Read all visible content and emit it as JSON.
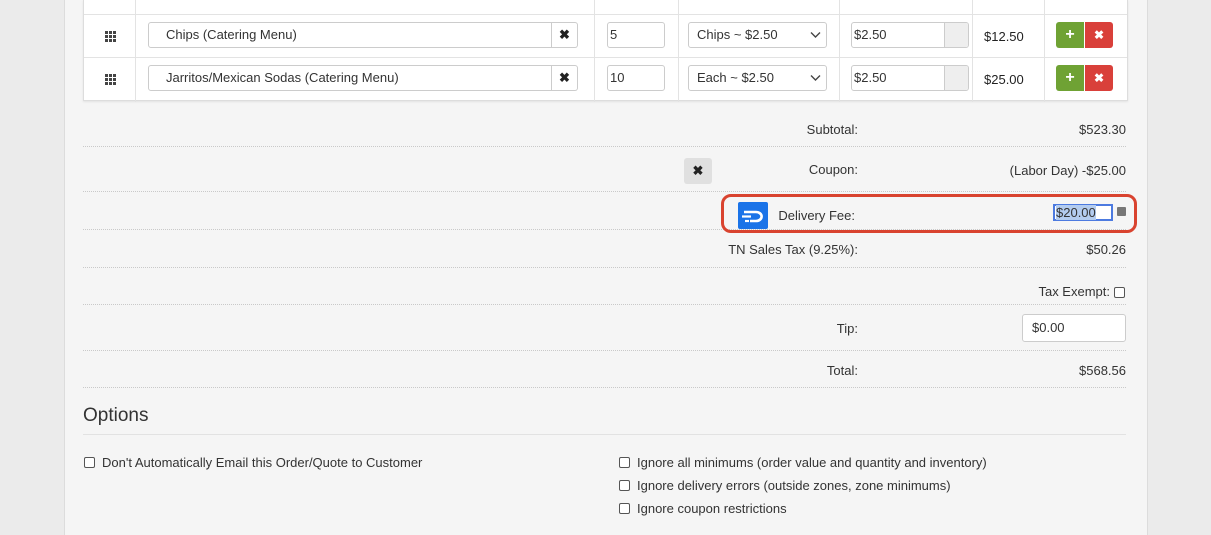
{
  "items": [
    {
      "name": "",
      "qty": "",
      "unit": "",
      "price": "",
      "total": ""
    },
    {
      "name": "Chips (Catering Menu)",
      "qty": "5",
      "unit": "Chips ~ $2.50",
      "price": "$2.50",
      "total": "$12.50"
    },
    {
      "name": "Jarritos/Mexican Sodas (Catering Menu)",
      "qty": "10",
      "unit": "Each ~ $2.50",
      "price": "$2.50",
      "total": "$25.00"
    }
  ],
  "buttons": {
    "clear": "✖",
    "add": "+",
    "remove": "✖"
  },
  "totals": {
    "subtotal_label": "Subtotal:",
    "subtotal_value": "$523.30",
    "coupon_label": "Coupon:",
    "coupon_value": "(Labor Day) -$25.00",
    "delivery_label": "Delivery Fee:",
    "delivery_value": "$20.00",
    "tax_label": "TN Sales Tax (9.25%):",
    "tax_value": "$50.26",
    "tax_exempt_label": "Tax Exempt:",
    "tip_label": "Tip:",
    "tip_value": "$0.00",
    "total_label": "Total:",
    "total_value": "$568.56"
  },
  "options": {
    "title": "Options",
    "left": [
      "Don't Automatically Email this Order/Quote to Customer"
    ],
    "right": [
      "Ignore all minimums (order value and quantity and inventory)",
      "Ignore delivery errors (outside zones, zone minimums)",
      "Ignore coupon restrictions"
    ]
  },
  "colors": {
    "accent_green": "#6fa234",
    "accent_red": "#d9403a",
    "highlight": "#d9432f",
    "doordash_blue": "#1a73e8"
  }
}
